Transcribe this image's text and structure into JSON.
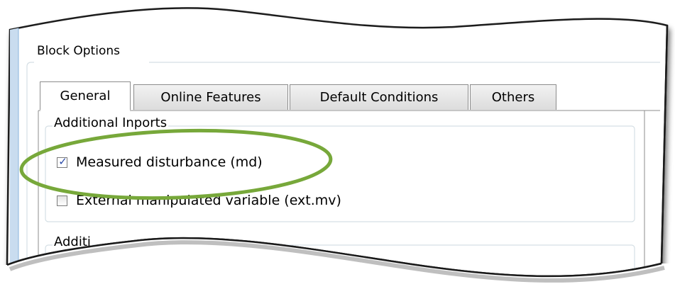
{
  "block_options": {
    "title": "Block Options"
  },
  "tabs": [
    {
      "label": "General",
      "active": true
    },
    {
      "label": "Online Features",
      "active": false
    },
    {
      "label": "Default Conditions",
      "active": false
    },
    {
      "label": "Others",
      "active": false
    }
  ],
  "additional_inports": {
    "title": "Additional Inports",
    "options": [
      {
        "label": "Measured disturbance (md)",
        "checked": true
      },
      {
        "label": "External manipulated variable (ext.mv)",
        "checked": false
      }
    ]
  },
  "second_group": {
    "title": "Additi"
  },
  "colors": {
    "highlight_ellipse": "#77a83a",
    "panel_left_edge": "#8ab4dc",
    "tab_border": "#8c8c8c"
  }
}
